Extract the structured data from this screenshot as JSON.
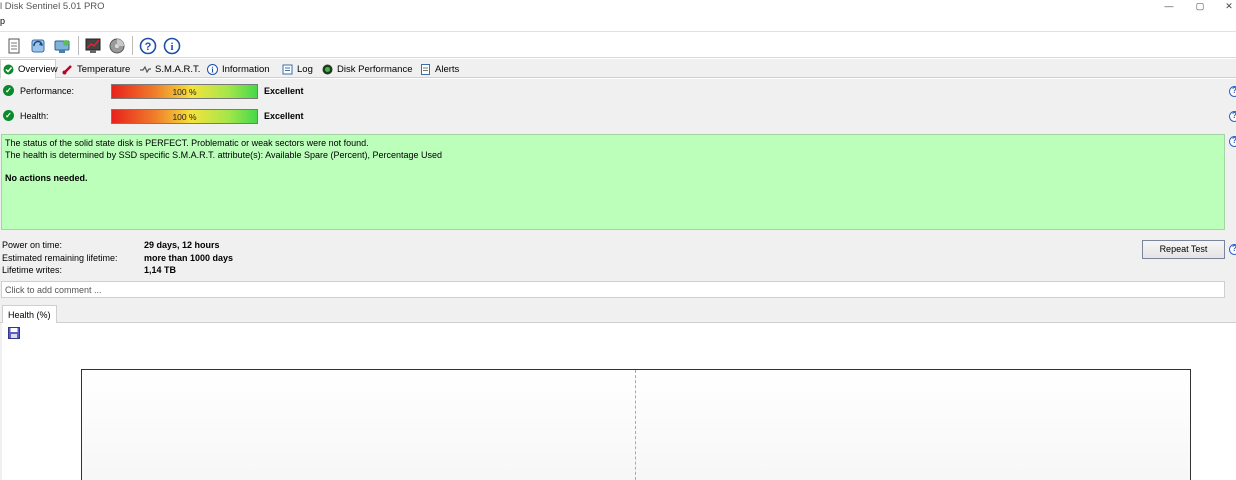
{
  "window": {
    "title": "l Disk Sentinel 5.01 PRO",
    "menu_item": "p",
    "controls": [
      "—",
      "▢",
      "✕"
    ]
  },
  "toolbar": {
    "icons": [
      "report-icon",
      "refresh-icon",
      "network-icon",
      "monitor-icon",
      "disk-icon",
      "help-icon",
      "info-icon"
    ]
  },
  "tabs": [
    {
      "label": "Overview",
      "icon": "check-icon",
      "active": true
    },
    {
      "label": "Temperature",
      "icon": "thermometer-icon"
    },
    {
      "label": "S.M.A.R.T.",
      "icon": "smart-icon"
    },
    {
      "label": "Information",
      "icon": "info-icon"
    },
    {
      "label": "Log",
      "icon": "log-icon"
    },
    {
      "label": "Disk Performance",
      "icon": "performance-icon"
    },
    {
      "label": "Alerts",
      "icon": "alerts-icon"
    }
  ],
  "performance": {
    "label": "Performance:",
    "percent_text": "100 %",
    "value": "Excellent",
    "percent": 100
  },
  "health": {
    "label": "Health:",
    "percent_text": "100 %",
    "value": "Excellent",
    "percent": 100
  },
  "health_box": {
    "line1": "The status of the solid state disk is PERFECT. Problematic or weak sectors were not found.",
    "line2": "The health is determined by SSD specific S.M.A.R.T. attribute(s):  Available Spare (Percent), Percentage Used",
    "action": "No actions needed."
  },
  "info": {
    "power_on_label": "Power on time:",
    "power_on_value": "29 days, 12 hours",
    "lifetime_label": "Estimated remaining lifetime:",
    "lifetime_value": "more than 1000 days",
    "writes_label": "Lifetime writes:",
    "writes_value": "1,14 TB"
  },
  "repeat_button": "Repeat Test",
  "comment_placeholder": "Click to add comment ...",
  "subtab": "Health (%)",
  "colors": {
    "health_box_bg": "#bbffbb",
    "check_green": "#0a8a2a",
    "help_blue": "#2a62c9"
  }
}
